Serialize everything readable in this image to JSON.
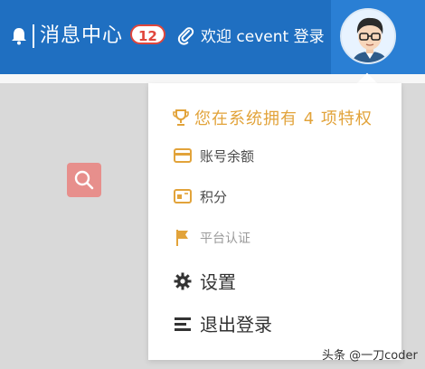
{
  "header": {
    "message_center_label": "消息中心",
    "unread_count": "12",
    "welcome_text": "欢迎 cevent 登录"
  },
  "dropdown": {
    "privilege_text": "您在系统拥有 4 项特权",
    "items": [
      {
        "label": "账号余额",
        "icon": "wallet-icon"
      },
      {
        "label": "积分",
        "icon": "points-card-icon"
      },
      {
        "label": "平台认证",
        "icon": "flag-icon"
      },
      {
        "label": "设置",
        "icon": "gear-icon"
      },
      {
        "label": "退出登录",
        "icon": "logout-icon"
      }
    ]
  },
  "watermark": "头条 @一刀coder",
  "colors": {
    "header_blue": "#1f6fc1",
    "privilege_gold": "#e2a33a",
    "badge_red": "#e0463c",
    "search_tile": "#e78f8c"
  }
}
